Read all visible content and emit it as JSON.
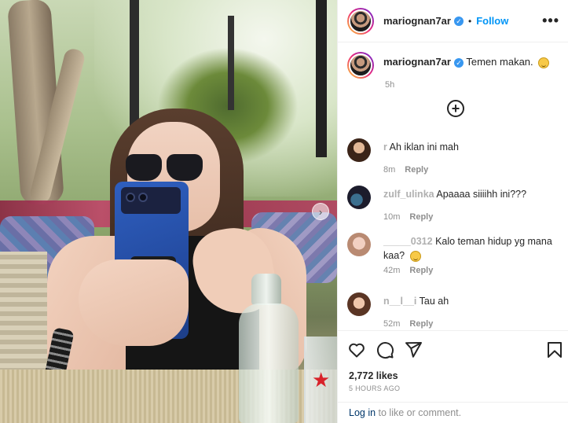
{
  "post": {
    "username": "mariognan7ar",
    "verified_glyph": "✓",
    "dot": "•",
    "follow_label": "Follow",
    "more_label": "•••",
    "caption_text": "Temen makan.",
    "caption_time": "5h",
    "carousel_next": "›",
    "load_more": "+"
  },
  "comments": [
    {
      "user": "r",
      "text": "Ah iklan ini mah",
      "time": "8m",
      "reply": "Reply"
    },
    {
      "user": "zulf_ulinka",
      "text": "Apaaaa siiiihh ini???",
      "time": "10m",
      "reply": "Reply"
    },
    {
      "user": "_____0312",
      "text": "Kalo teman hidup yg mana kaa?",
      "time": "42m",
      "reply": "Reply"
    },
    {
      "user": "n__l__i",
      "text": "Tau ah",
      "time": "52m",
      "reply": "Reply"
    }
  ],
  "stats": {
    "likes": "2,772 likes",
    "ago": "5 HOURS AGO"
  },
  "footer": {
    "login_link": "Log in",
    "login_rest": " to like or comment."
  },
  "icons": {
    "like": "heart-icon",
    "comment": "comment-icon",
    "share": "share-icon",
    "save": "bookmark-icon"
  },
  "colors": {
    "accent": "#0095f6",
    "verified": "#3897f0",
    "muted": "#8e8e8e"
  }
}
